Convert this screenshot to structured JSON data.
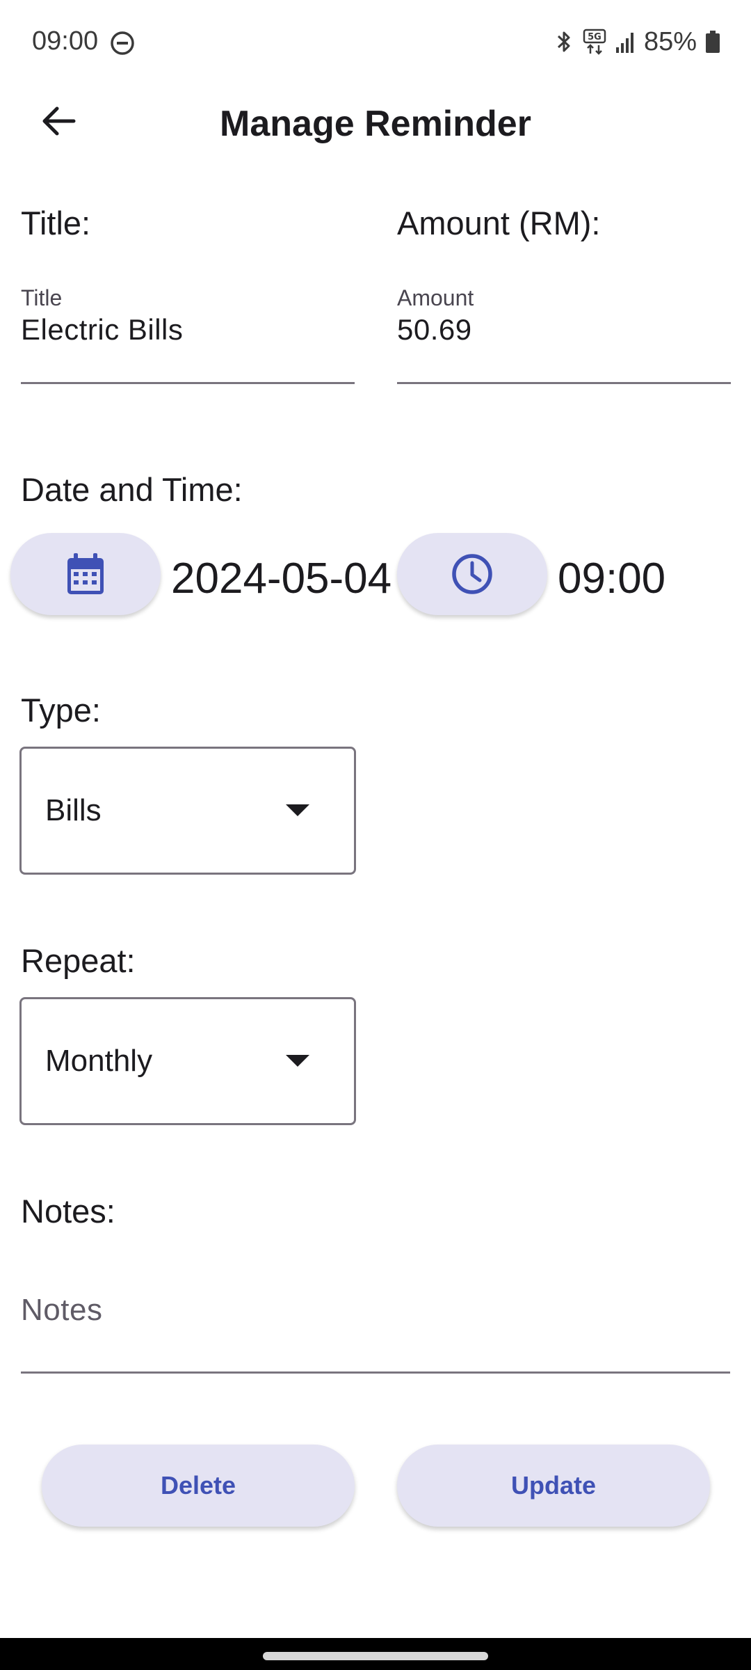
{
  "status_bar": {
    "time": "09:00",
    "battery": "85%",
    "icons": [
      "do-not-disturb-icon",
      "bluetooth-icon",
      "5g-icon",
      "signal-icon",
      "battery-icon"
    ]
  },
  "app_bar": {
    "title": "Manage Reminder",
    "back_icon": "arrow-back-icon"
  },
  "form": {
    "title_label": "Title:",
    "title_field": {
      "label": "Title",
      "value": "Electric Bills"
    },
    "amount_label": "Amount (RM):",
    "amount_field": {
      "label": "Amount",
      "value": "50.69"
    },
    "datetime_label": "Date and Time:",
    "date_value": "2024-05-04",
    "time_value": "09:00",
    "type_label": "Type:",
    "type_value": "Bills",
    "repeat_label": "Repeat:",
    "repeat_value": "Monthly",
    "notes_label": "Notes:",
    "notes_placeholder": "Notes"
  },
  "actions": {
    "delete": "Delete",
    "update": "Update"
  },
  "colors": {
    "accent": "#3f51b5",
    "button_bg": "#e4e3f3",
    "outline": "#79747e"
  }
}
